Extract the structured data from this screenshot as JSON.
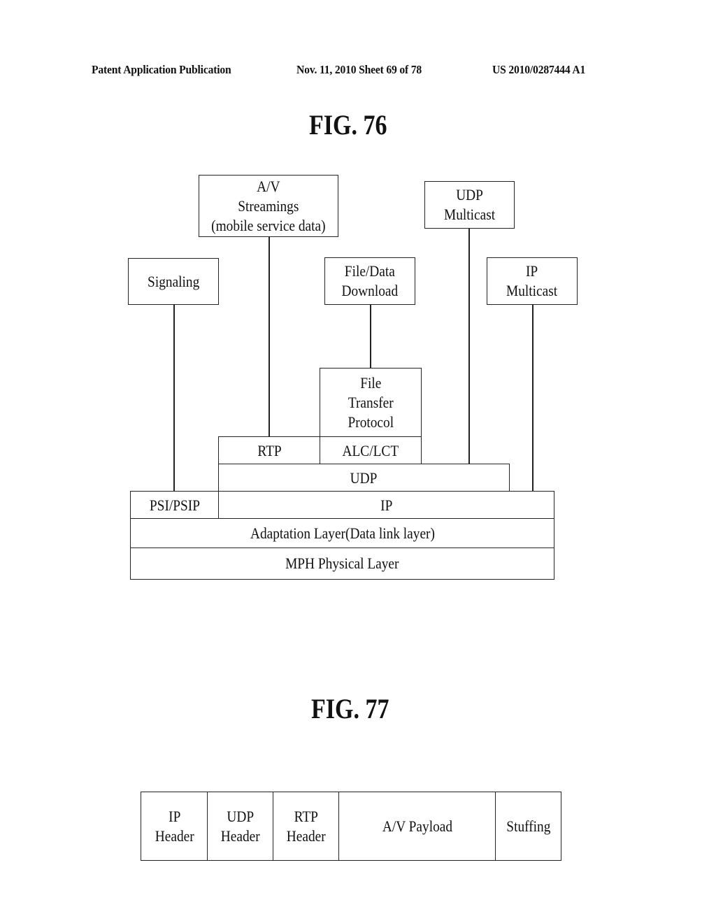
{
  "header": {
    "left": "Patent Application Publication",
    "middle": "Nov. 11, 2010  Sheet 69 of 78",
    "right": "US 2010/0287444 A1"
  },
  "fig76": {
    "title": "FIG. 76",
    "apps": {
      "av_streaming": [
        "A/V",
        "Streamings",
        "(mobile service data)"
      ],
      "signaling": [
        "Signaling"
      ],
      "file_download": [
        "File/Data",
        "Download"
      ],
      "udp_multicast": [
        "UDP",
        "Multicast"
      ],
      "ip_multicast": [
        "IP",
        "Multicast"
      ]
    },
    "layers": {
      "ftp": [
        "File",
        "Transfer",
        "Protocol"
      ],
      "rtp": "RTP",
      "alc_lct": "ALC/LCT",
      "udp": "UDP",
      "psi_psip": "PSI/PSIP",
      "ip": "IP",
      "adaptation": "Adaptation Layer(Data link layer)",
      "physical": "MPH Physical Layer"
    }
  },
  "fig77": {
    "title": "FIG. 77",
    "fields": [
      [
        "IP",
        "Header"
      ],
      [
        "UDP",
        "Header"
      ],
      [
        "RTP",
        "Header"
      ],
      [
        "A/V Payload"
      ],
      [
        "Stuffing"
      ]
    ]
  }
}
